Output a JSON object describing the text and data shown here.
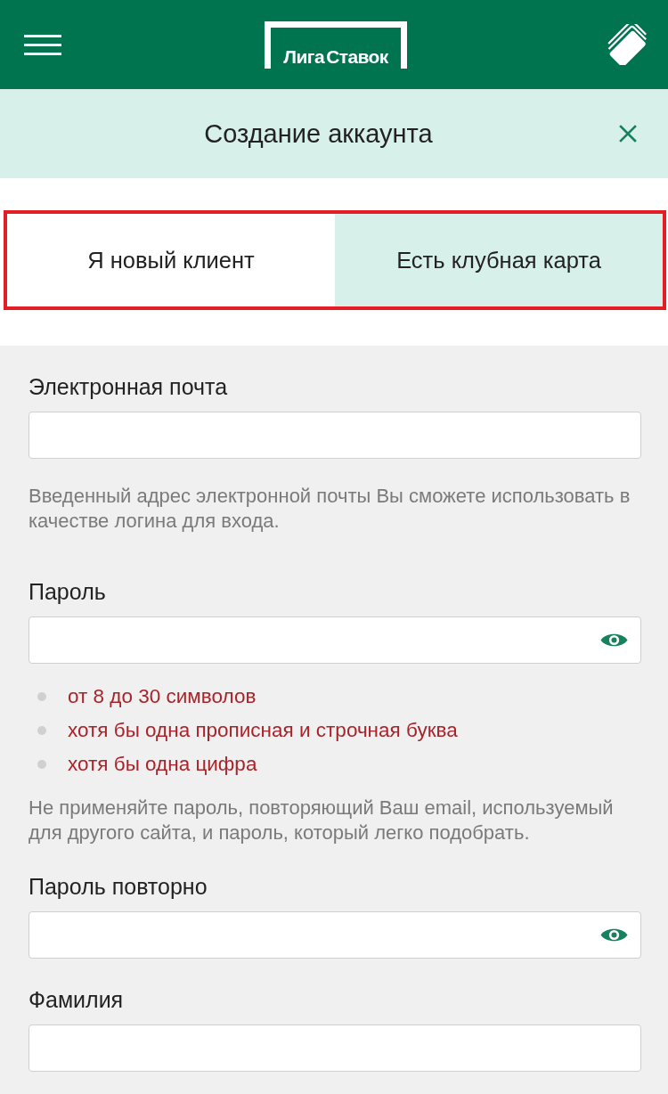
{
  "header": {
    "logo": "Лига Ставок"
  },
  "title_bar": {
    "title": "Создание аккаунта"
  },
  "tabs": {
    "highlighted": true,
    "items": [
      {
        "label": "Я новый клиент",
        "selected": true
      },
      {
        "label": "Есть клубная карта",
        "selected": false
      }
    ]
  },
  "form": {
    "fields": [
      {
        "kind": "text",
        "label": "Электронная почта",
        "hint": "Введенный адрес электронной почты Вы сможете использовать в качестве логина для входа."
      },
      {
        "kind": "password",
        "label": "Пароль",
        "requirements": [
          {
            "text": "от 8 до 30 символов",
            "met": false
          },
          {
            "text": "хотя бы одна прописная и строчная буква",
            "met": false
          },
          {
            "text": "хотя бы одна цифра",
            "met": false
          }
        ],
        "note": "Не применяйте пароль, повторяющий Ваш email, используемый для другого сайта, и пароль, который легко подобрать."
      },
      {
        "kind": "password",
        "label": "Пароль повторно"
      },
      {
        "kind": "text",
        "label": "Фамилия"
      }
    ]
  }
}
